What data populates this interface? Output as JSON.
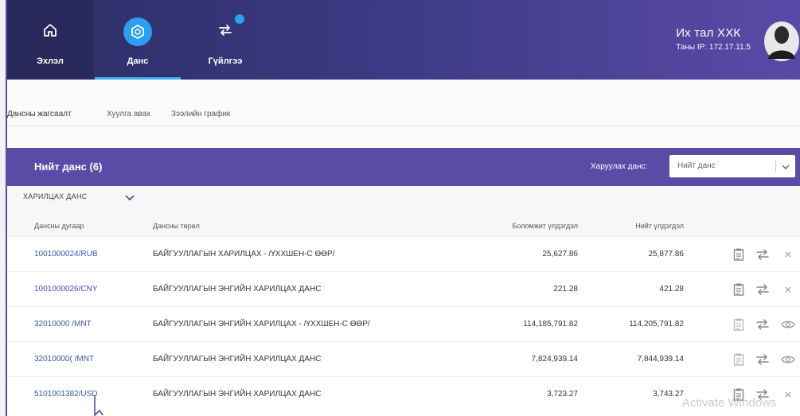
{
  "nav": {
    "items": [
      {
        "label": "Эхлэл",
        "icon": "home-icon"
      },
      {
        "label": "Данс",
        "icon": "account-icon"
      },
      {
        "label": "Гүйлгээ",
        "icon": "transfer-icon"
      }
    ]
  },
  "user": {
    "company": "Их тал ХХК",
    "ip": "Таны IP: 172.17.11.5"
  },
  "subtabs": [
    "Дансны жагсаалт",
    "Хуулга авах",
    "Зээлийн график"
  ],
  "panel": {
    "title": "Нийт данс (6)",
    "select_label": "Харуулах данс:",
    "select_value": "Нийт данс",
    "group": "ХАРИЛЦАХ ДАНС",
    "columns": [
      "Дансны дугаар",
      "Дансны төрөл",
      "Боломжит үлдэгдэл",
      "Нийт үлдэгдэл"
    ],
    "rows": [
      {
        "account": "1001000024/RUB",
        "type": "БАЙГУУЛЛАГЫН ХАРИЛЦАХ - /ҮХХШЕН-С ӨӨР/",
        "available": "25,627.86",
        "total": "25,877.86"
      },
      {
        "account": "1001000026/CNY",
        "type": "БАЙГУУЛЛАГЫН ЭНГИЙН ХАРИЛЦАХ ДАНС",
        "available": "221.28",
        "total": "421.28"
      },
      {
        "account": "32010000   /MNT",
        "type": "БАЙГУУЛЛАГЫН ЭНГИЙН ХАРИЛЦАХ - /ҮХХШЕН-С ӨӨР/",
        "available": "114,185,791.82",
        "total": "114,205,791.82"
      },
      {
        "account": "32010000(   /MNT",
        "type": "БАЙГУУЛЛАГЫН ЭНГИЙН ХАРИЛЦАХ ДАНС",
        "available": "7,824,939.14",
        "total": "7,844,939.14"
      },
      {
        "account": "5101001382/USD",
        "type": "БАЙГУУЛЛАГЫН ЭНГИЙН ХАРИЛЦАХ ДАНС",
        "available": "3,723.27",
        "total": "3,743.27"
      }
    ]
  },
  "watermark": "Activate Windows",
  "colors": {
    "header": "#3a3982",
    "accent": "#2aa0ee",
    "panel": "#5a4ba6",
    "link": "#3a55a8"
  }
}
